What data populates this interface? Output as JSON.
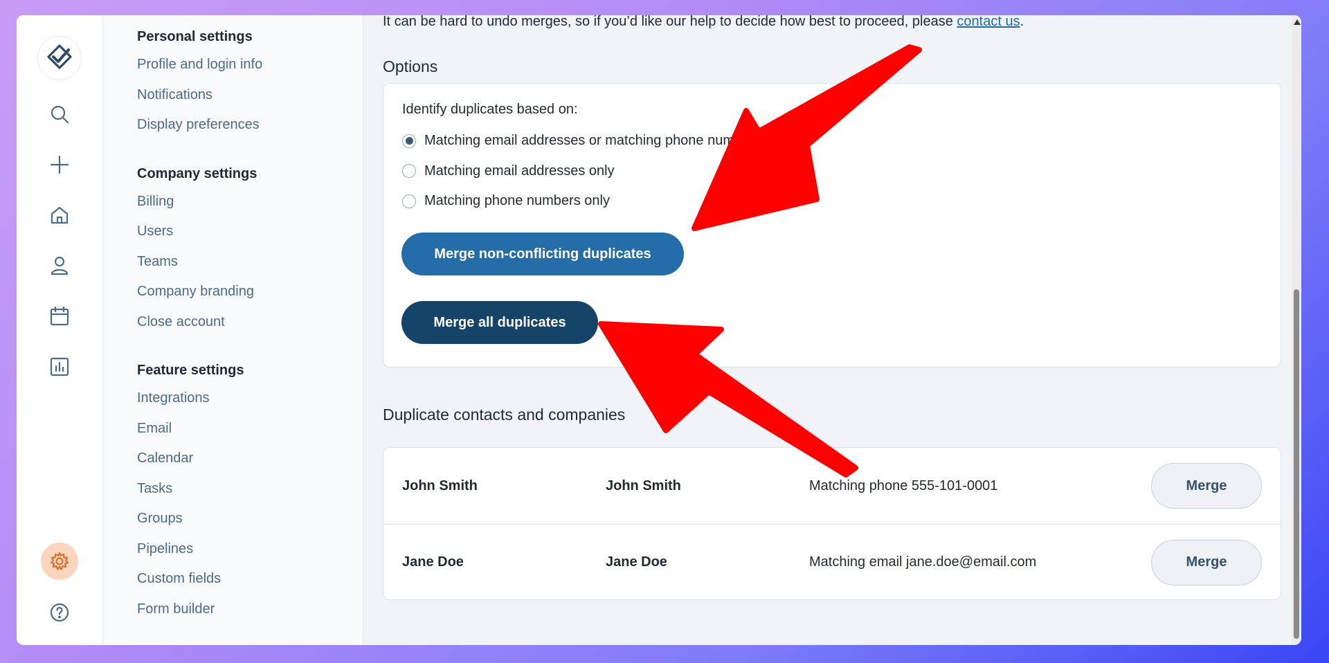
{
  "intro": {
    "text": "It can be hard to undo merges, so if you’d like our help to decide how best to proceed, please ",
    "link": "contact us",
    "suffix": "."
  },
  "nav": {
    "personal": {
      "heading": "Personal settings",
      "items": [
        "Profile and login info",
        "Notifications",
        "Display preferences"
      ]
    },
    "company": {
      "heading": "Company settings",
      "items": [
        "Billing",
        "Users",
        "Teams",
        "Company branding",
        "Close account"
      ]
    },
    "feature": {
      "heading": "Feature settings",
      "items": [
        "Integrations",
        "Email",
        "Calendar",
        "Tasks",
        "Groups",
        "Pipelines",
        "Custom fields",
        "Form builder"
      ]
    }
  },
  "options": {
    "title": "Options",
    "label": "Identify duplicates based on:",
    "radios": [
      {
        "label": "Matching email addresses or matching phone numbers",
        "checked": true
      },
      {
        "label": "Matching email addresses only",
        "checked": false
      },
      {
        "label": "Matching phone numbers only",
        "checked": false
      }
    ],
    "merge_non_conflicting": "Merge non-conflicting duplicates",
    "merge_all": "Merge all duplicates"
  },
  "duplicates": {
    "title": "Duplicate contacts and companies",
    "rows": [
      {
        "a": "John Smith",
        "b": "John Smith",
        "match": "Matching phone 555-101-0001",
        "action": "Merge"
      },
      {
        "a": "Jane Doe",
        "b": "Jane Doe",
        "match": "Matching email jane.doe@email.com",
        "action": "Merge"
      }
    ]
  },
  "colors": {
    "primary_button": "#256da9",
    "dark_button": "#164469",
    "settings_active": "#fcd5bd",
    "arrow": "#ff0000"
  },
  "icons": [
    "logo-check-icon",
    "search-icon",
    "plus-icon",
    "home-icon",
    "person-icon",
    "calendar-icon",
    "chart-icon",
    "gear-icon",
    "help-icon"
  ]
}
